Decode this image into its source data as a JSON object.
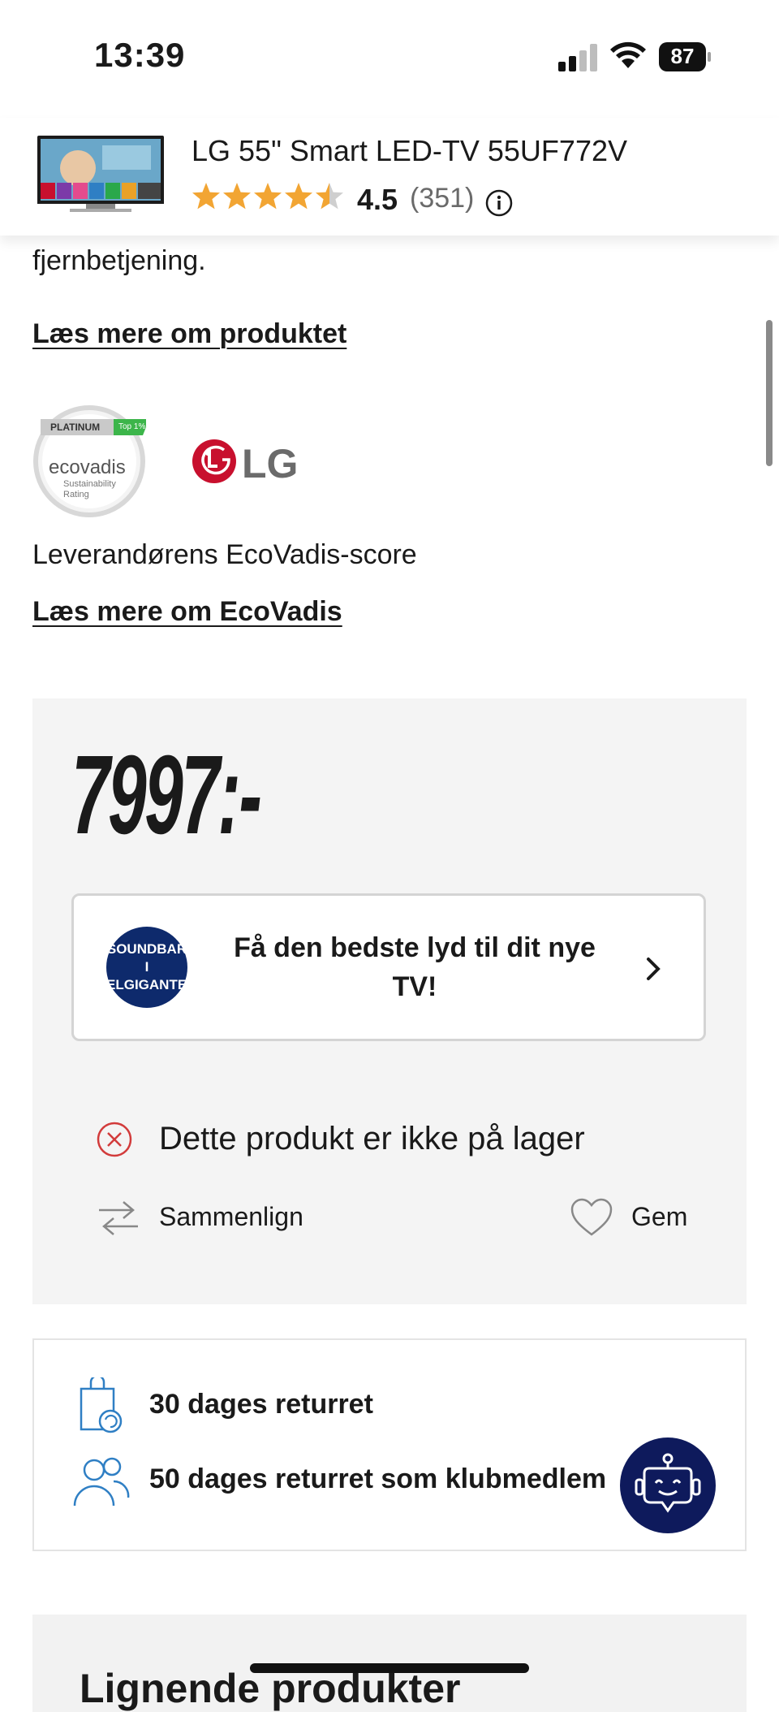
{
  "status_bar": {
    "time": "13:39",
    "battery": "87"
  },
  "header": {
    "title": "LG 55\" Smart LED-TV 55UF772V",
    "rating": "4.5",
    "rating_count": "(351)",
    "stars": 4.5
  },
  "description_tail": "fjernbetjening.",
  "read_more_product": "Læs mere om produktet",
  "ecovadis": {
    "badge_label": "ecovadis",
    "tier": "PLATINUM",
    "top": "Top 1%",
    "sub1": "Sustainability",
    "sub2": "Rating",
    "supplier_score_label": "Leverandørens EcoVadis-score",
    "read_more": "Læs mere om EcoVadis"
  },
  "brand_logo_text": "LG",
  "price": "7997:-",
  "promo": {
    "logo_line1": "SOUNDBAR I",
    "logo_line2": "ELGIGANTEN",
    "text": "Få den bedste lyd til dit nye TV!"
  },
  "stock_status": "Dette produkt er ikke på lager",
  "compare_label": "Sammenlign",
  "save_label": "Gem",
  "returns": {
    "line1": "30 dages returret",
    "line2": "50 dages returret som klubmedlem"
  },
  "similar_title": "Lignende produkter",
  "colors": {
    "accent_blue": "#2f7fc4",
    "error_red": "#d23b3b",
    "navy": "#0e1a5c",
    "star": "#f2a533"
  }
}
